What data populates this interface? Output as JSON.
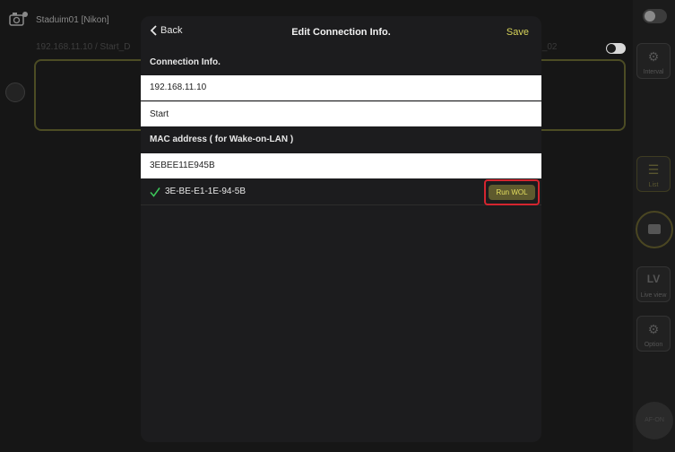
{
  "background": {
    "camera_name": "Staduim01 [Nikon]",
    "subline": "192.168.11.10 / Start_D",
    "subline_right": "_l_02"
  },
  "right_panel": {
    "interval_label": "Interval",
    "list_label": "List",
    "liveview_icon": "LV",
    "liveview_label": "Live view",
    "option_label": "Option",
    "af_on_label": "AF-ON"
  },
  "modal": {
    "back_label": "Back",
    "title": "Edit Connection Info.",
    "save_label": "Save",
    "connection_section": "Connection Info.",
    "ip_value": "192.168.11.10",
    "name_value": "Start",
    "mac_section": "MAC address ( for Wake-on-LAN )",
    "mac_input_value": "3EBEE11E945B",
    "mac_formatted": "3E-BE-E1-1E-94-5B",
    "wol_button": "Run WOL"
  },
  "colors": {
    "accent": "#d8d45a",
    "highlight": "#d4252f",
    "check": "#3cc75a"
  }
}
